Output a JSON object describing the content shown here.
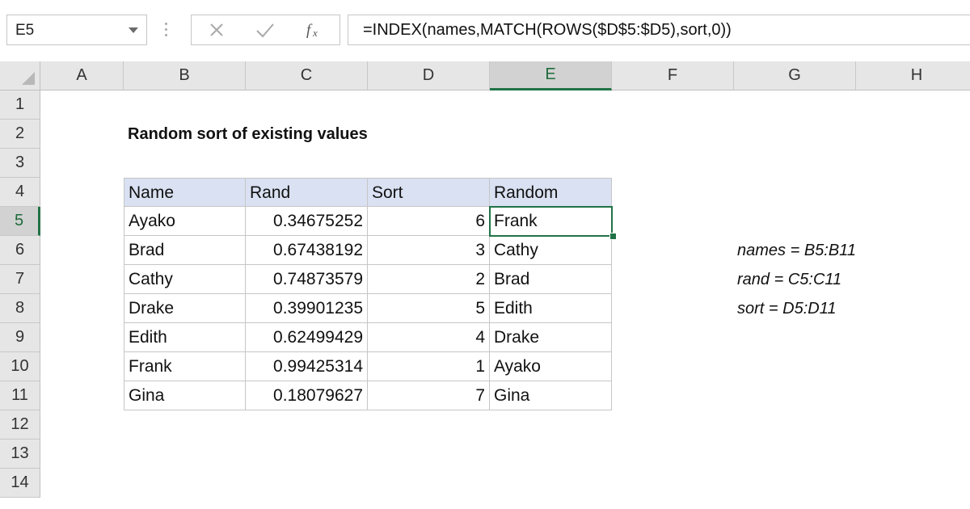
{
  "formula_bar": {
    "name_box": "E5",
    "formula": "=INDEX(names,MATCH(ROWS($D$5:$D5),sort,0))",
    "icons": {
      "cancel": "close-icon",
      "enter": "check-icon",
      "function": "fx-icon"
    }
  },
  "columns": [
    "A",
    "B",
    "C",
    "D",
    "E",
    "F",
    "G",
    "H"
  ],
  "rows": [
    "1",
    "2",
    "3",
    "4",
    "5",
    "6",
    "7",
    "8",
    "9",
    "10",
    "11",
    "12",
    "13",
    "14"
  ],
  "sheet": {
    "title": "Random sort of existing values",
    "table": {
      "headers": [
        "Name",
        "Rand",
        "Sort",
        "Random"
      ],
      "rows": [
        [
          "Ayako",
          "0.34675252",
          "6",
          "Frank"
        ],
        [
          "Brad",
          "0.67438192",
          "3",
          "Cathy"
        ],
        [
          "Cathy",
          "0.74873579",
          "2",
          "Brad"
        ],
        [
          "Drake",
          "0.39901235",
          "5",
          "Edith"
        ],
        [
          "Edith",
          "0.62499429",
          "4",
          "Drake"
        ],
        [
          "Frank",
          "0.99425314",
          "1",
          "Ayako"
        ],
        [
          "Gina",
          "0.18079627",
          "7",
          "Gina"
        ]
      ]
    },
    "named_ranges": [
      "names = B5:B11",
      "rand = C5:C11",
      "sort = D5:D11"
    ]
  },
  "selection": {
    "active_cell": "E5",
    "column": "E",
    "row": "5"
  },
  "colors": {
    "accent": "#217346",
    "table_header": "#d9e1f2",
    "header_bg": "#e6e6e6"
  }
}
